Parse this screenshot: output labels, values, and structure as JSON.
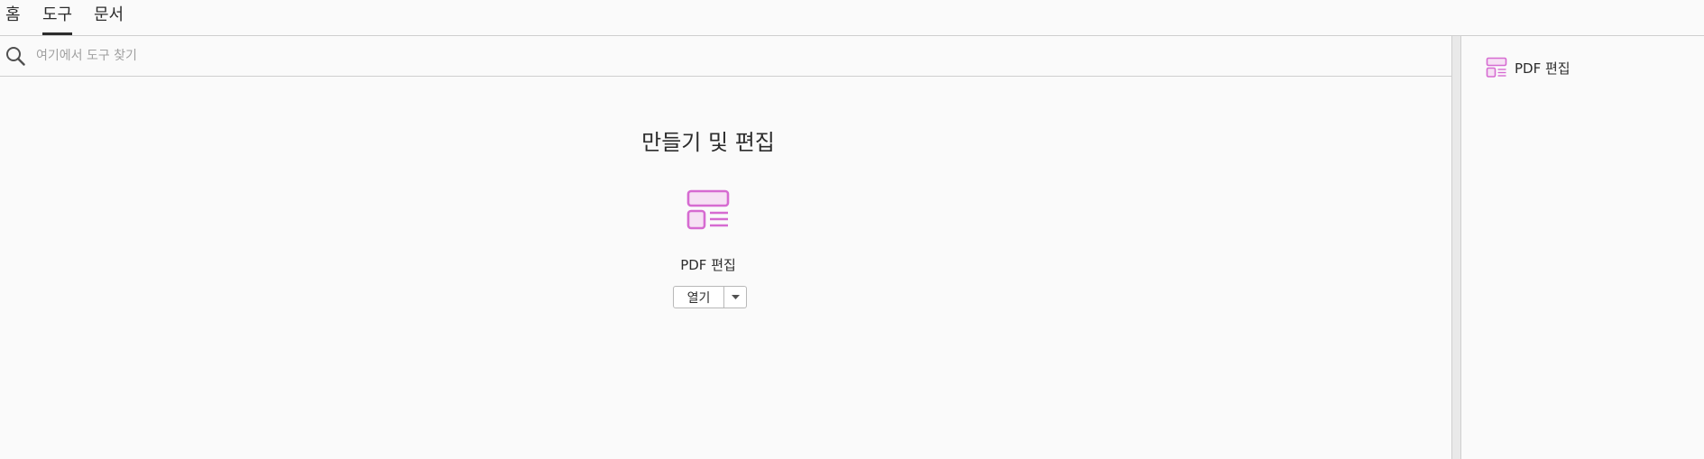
{
  "tabs": [
    {
      "label": "홈"
    },
    {
      "label": "도구"
    },
    {
      "label": "문서"
    }
  ],
  "active_tab": "도구",
  "search": {
    "placeholder": "여기에서 도구 찾기",
    "value": ""
  },
  "section": {
    "title": "만들기 및 편집"
  },
  "tool": {
    "name": "PDF 편집",
    "icon": "edit-pdf-icon",
    "open_label": "열기"
  },
  "right_panel": {
    "items": [
      {
        "label": "PDF 편집",
        "icon": "edit-pdf-icon"
      }
    ]
  },
  "colors": {
    "accent": "#d66bd1",
    "accent_fill": "#f6e1f4",
    "text": "#2c2c2c",
    "border": "#cfcfcf"
  }
}
